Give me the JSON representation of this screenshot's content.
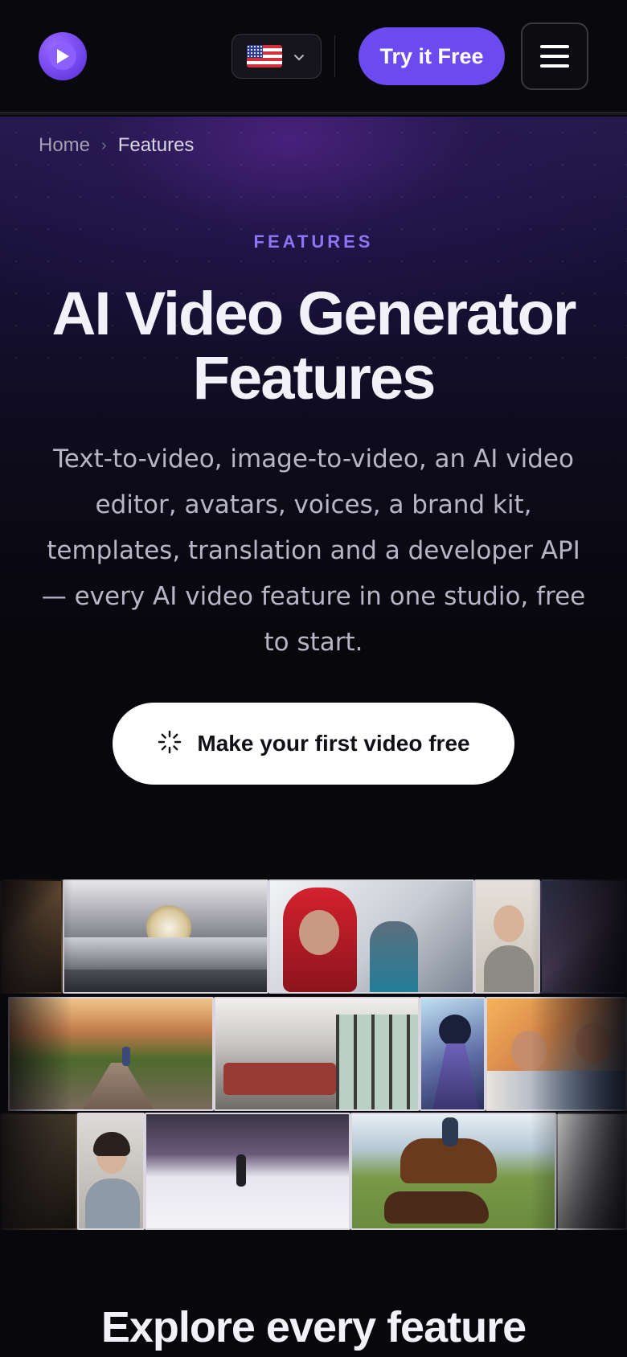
{
  "header": {
    "logo_icon": "play-icon",
    "language": {
      "flag_icon": "us-flag-icon",
      "chevron_icon": "chevron-down-icon"
    },
    "try_label": "Try it Free",
    "menu_icon": "hamburger-menu-icon"
  },
  "breadcrumb": {
    "home": "Home",
    "separator": "›",
    "current": "Features"
  },
  "hero": {
    "eyebrow": "FEATURES",
    "title": "AI Video Generator Features",
    "description": "Text-to-video, image-to-video, an AI video editor, avatars, voices, a brand kit, templates, translation and a developer API — every AI video feature in one studio, free to start.",
    "cta_icon": "sparkle-loader-icon",
    "cta_label": "Make your first video free"
  },
  "collage": {
    "tiles": [
      "dark-interior-clip",
      "luxury-watch-clip",
      "mountaineers-snow-clip",
      "woman-portrait-clip",
      "crowd-concert-clip",
      "sunset-runner-road-clip",
      "office-interior-clip",
      "anime-warrior-clip",
      "friends-laughing-clip",
      "cave-dim-clip",
      "woman-avatar-speaking-clip",
      "figure-skater-arena-clip",
      "cowboy-horses-field-clip",
      "monochrome-light-clip"
    ]
  },
  "explore": {
    "heading": "Explore every feature"
  },
  "colors": {
    "accent": "#6b4af0",
    "eyebrow": "#8f74f5",
    "background": "#08070c",
    "text": "#f3f1f8"
  }
}
